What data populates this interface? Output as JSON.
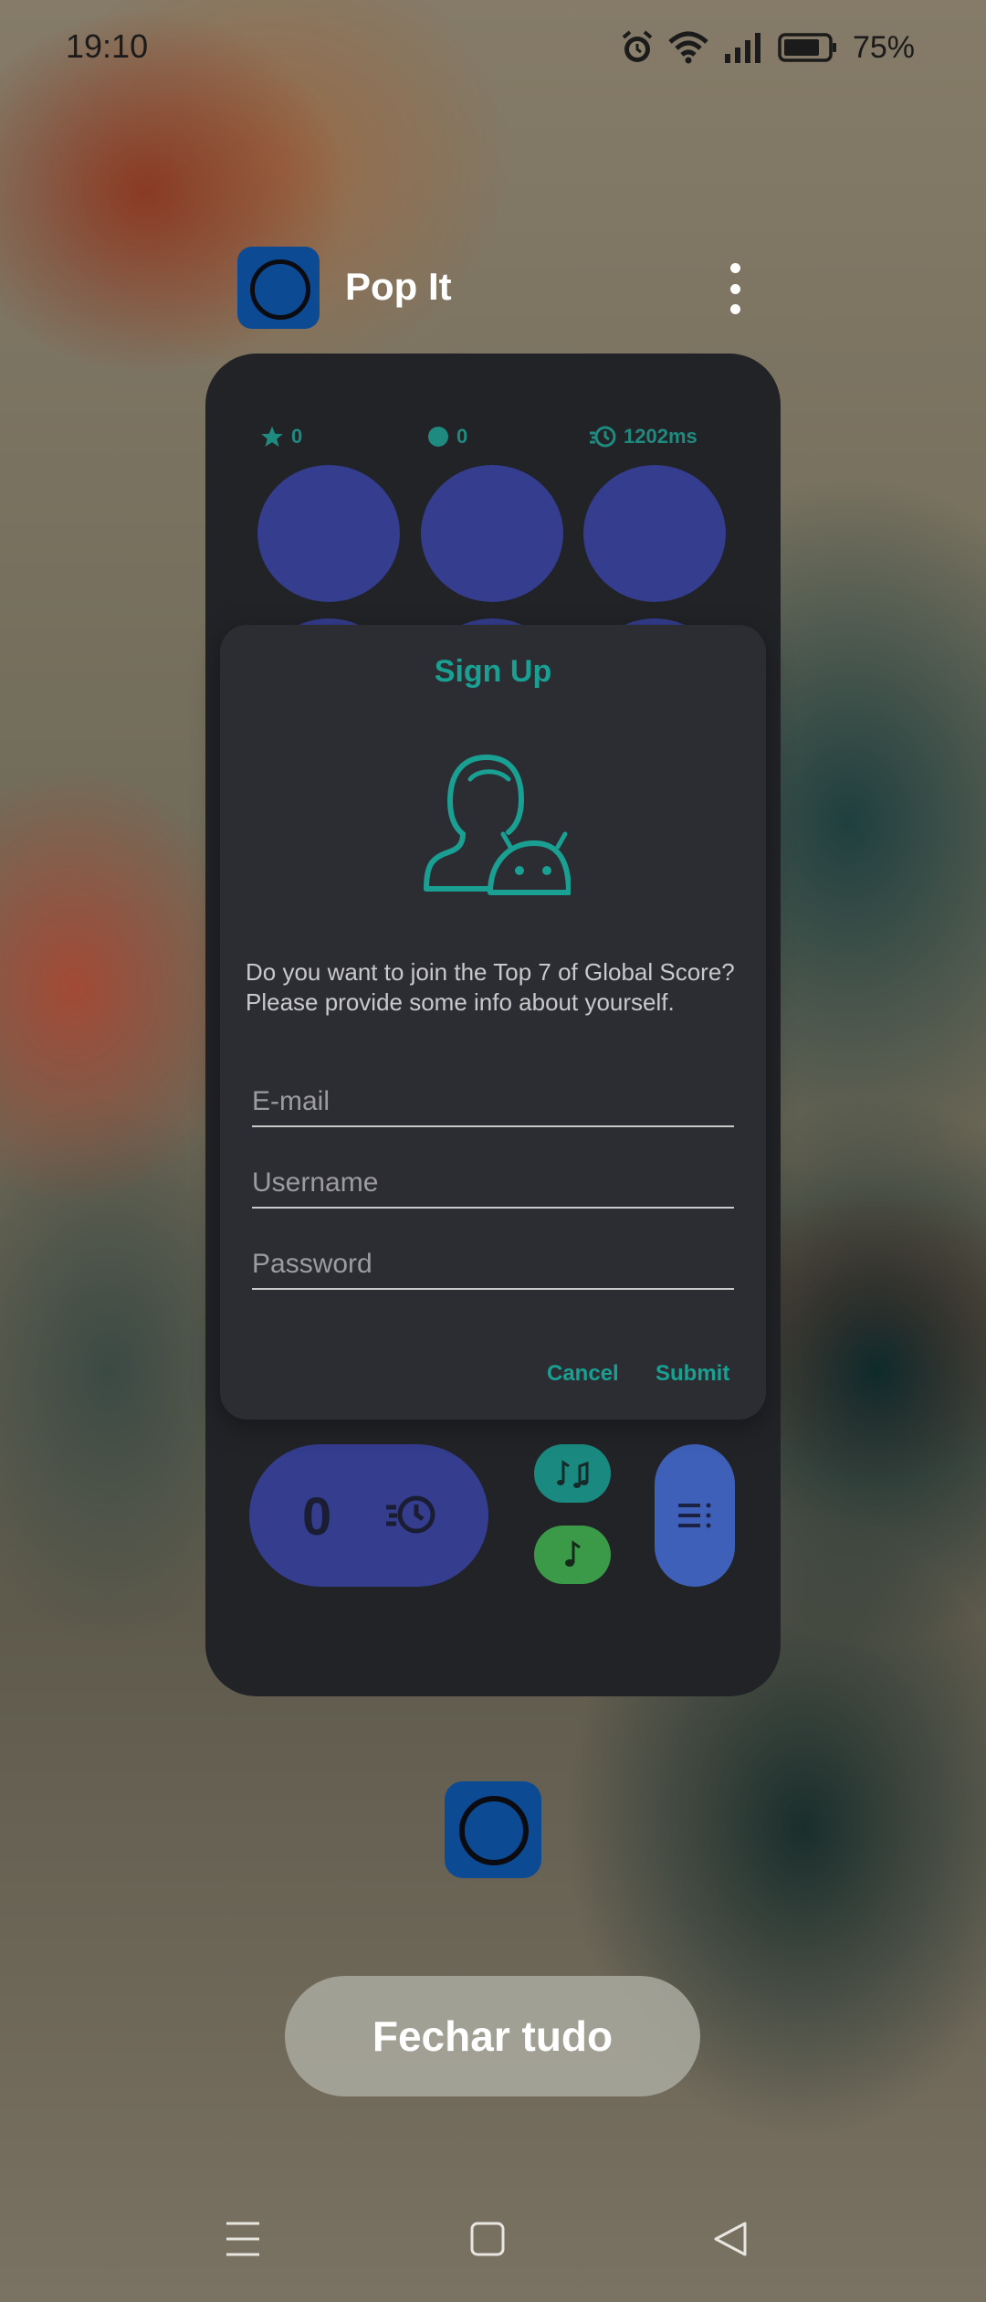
{
  "status_bar": {
    "time": "19:10",
    "battery_percent": "75%"
  },
  "app_header": {
    "name": "Pop It"
  },
  "game": {
    "stats": {
      "stars": "0",
      "pops": "0",
      "time": "1202ms"
    },
    "score": "0"
  },
  "dialog": {
    "title": "Sign Up",
    "message_line1": "Do you want to join the Top 7 of Global Score?",
    "message_line2": "Please provide some info about yourself.",
    "email_placeholder": "E-mail",
    "username_placeholder": "Username",
    "password_placeholder": "Password",
    "cancel_label": "Cancel",
    "submit_label": "Submit"
  },
  "close_all_label": "Fechar tudo",
  "colors": {
    "accent": "#19a093",
    "bubble": "#343d8e",
    "music_on": "#1a8a80",
    "music_note": "#3a9a48",
    "menu": "#3e60b8",
    "app_icon": "#0d4a94"
  },
  "icons": [
    "alarm-icon",
    "wifi-icon",
    "signal-icon",
    "battery-icon",
    "star-icon",
    "dot-icon",
    "history-speed-icon",
    "user-android-icon",
    "music-notes-icon",
    "music-note-icon",
    "menu-list-icon",
    "recents-icon",
    "home-icon",
    "back-icon"
  ]
}
